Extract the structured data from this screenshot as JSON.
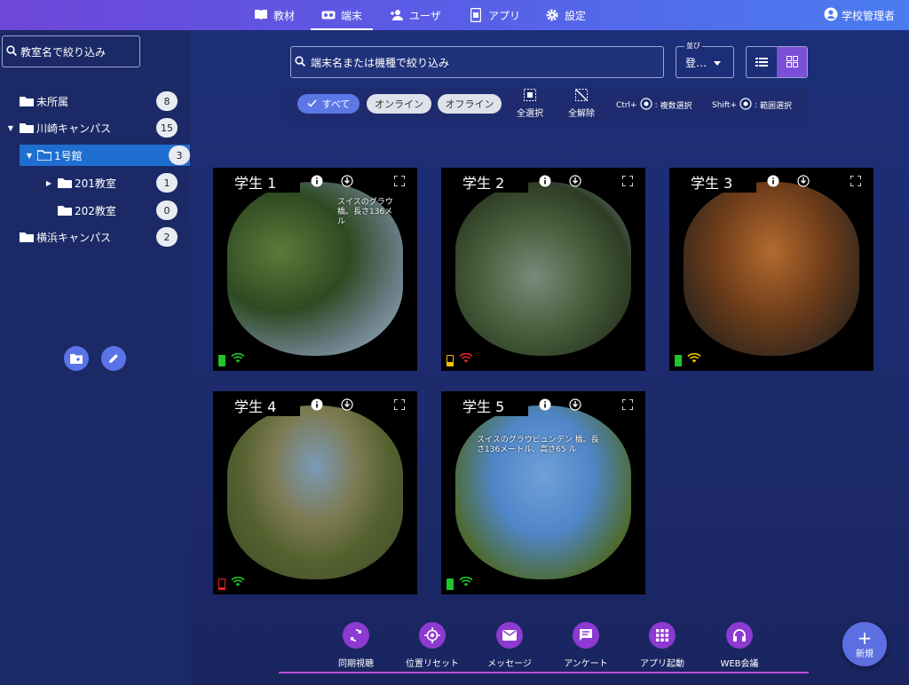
{
  "topbar": {
    "nav": [
      {
        "label": "教材",
        "icon": "book-icon"
      },
      {
        "label": "端末",
        "icon": "vr-headset-icon"
      },
      {
        "label": "ユーザ",
        "icon": "add-user-icon"
      },
      {
        "label": "アプリ",
        "icon": "app-icon"
      },
      {
        "label": "設定",
        "icon": "gear-icon"
      }
    ],
    "active_nav": "端末",
    "account": "学校管理者"
  },
  "sidebar": {
    "search_placeholder": "教室名で絞り込み",
    "tree": [
      {
        "label": "未所属",
        "count": "8"
      },
      {
        "label": "川崎キャンパス",
        "count": "15"
      },
      {
        "label": "1号館",
        "count": "3"
      },
      {
        "label": "201教室",
        "count": "1"
      },
      {
        "label": "202教室",
        "count": "0"
      },
      {
        "label": "横浜キャンパス",
        "count": "2"
      }
    ],
    "selected": "1号館"
  },
  "search": {
    "placeholder": "端末名または機種で絞り込み"
  },
  "sort": {
    "label": "並び",
    "value": "登…"
  },
  "filters": {
    "all": "すべて",
    "online": "オンライン",
    "offline": "オフライン",
    "select_all": "全選択",
    "deselect_all": "全解除",
    "ctrl_hint_key": "Ctrl+",
    "ctrl_hint": "複数選択",
    "shift_hint_key": "Shift+",
    "shift_hint": "範囲選択"
  },
  "devices": [
    {
      "name": "学生 1",
      "battery": "full",
      "battery_color": "#21c42a",
      "wifi_color": "#21c42a",
      "overlay_text": "スイスのグラウ 橋。長さ136メ ル"
    },
    {
      "name": "学生 2",
      "battery": "low",
      "battery_color": "#f2c200",
      "wifi_color": "#e0252e",
      "overlay_text": ""
    },
    {
      "name": "学生 3",
      "battery": "full",
      "battery_color": "#21c42a",
      "wifi_color": "#f2c200",
      "overlay_text": ""
    },
    {
      "name": "学生 4",
      "battery": "critical",
      "battery_color": "#e0252e",
      "wifi_color": "#21c42a",
      "overlay_text": ""
    },
    {
      "name": "学生 5",
      "battery": "full",
      "battery_color": "#21c42a",
      "wifi_color": "#21c42a",
      "overlay_text": "スイスのグラウビュンデン 橋。長さ136メートル、高さ65 ル"
    }
  ],
  "dock": [
    {
      "label": "同期視聴",
      "icon": "sync-icon"
    },
    {
      "label": "位置リセット",
      "icon": "crosshair-icon"
    },
    {
      "label": "メッセージ",
      "icon": "mail-icon"
    },
    {
      "label": "アンケート",
      "icon": "survey-icon"
    },
    {
      "label": "アプリ起動",
      "icon": "grid-apps-icon"
    },
    {
      "label": "WEB会議",
      "icon": "headset-icon"
    }
  ],
  "fab": {
    "symbol": "+",
    "label": "新規"
  },
  "colors": {
    "accent": "#7b4fd8",
    "selected": "#1f6fd1",
    "dock_icon": "#8c3ad1"
  }
}
